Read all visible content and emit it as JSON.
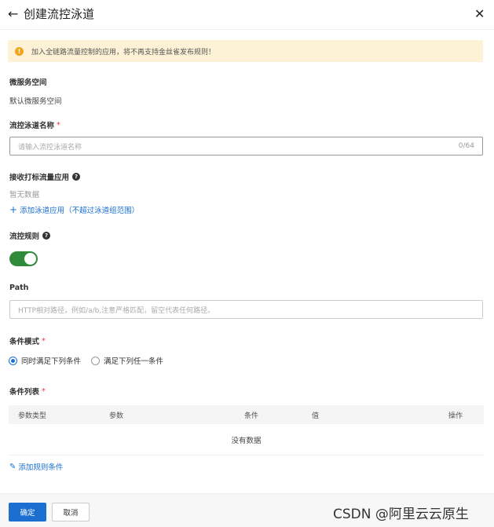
{
  "header": {
    "title": "创建流控泳道"
  },
  "alert": {
    "text": "加入全链路流量控制的应用，将不再支持金丝雀发布规则！"
  },
  "namespace": {
    "label": "微服务空间",
    "value": "默认微服务空间"
  },
  "lane_name": {
    "label": "流控泳道名称",
    "required_mark": "*",
    "placeholder": "请输入流控泳道名称",
    "counter": "0/64"
  },
  "receive_apps": {
    "label": "接收打标流量应用",
    "empty_text": "暂无数据",
    "add_link": "添加泳道应用（不超过泳道组范围）"
  },
  "rules": {
    "label": "流控规则",
    "enabled": true
  },
  "path": {
    "label": "Path",
    "placeholder": "HTTP相对路径，例如/a/b,注意严格匹配，留空代表任何路径。"
  },
  "condition_mode": {
    "label": "条件模式",
    "required_mark": "*",
    "options": [
      "同时满足下列条件",
      "满足下列任一条件"
    ],
    "selected": "同时满足下列条件"
  },
  "condition_list": {
    "label": "条件列表",
    "required_mark": "*",
    "columns": [
      "参数类型",
      "参数",
      "条件",
      "值",
      "操作"
    ],
    "empty_text": "没有数据",
    "add_link": "添加规则条件"
  },
  "footer": {
    "confirm": "确定",
    "cancel": "取消"
  },
  "watermark": "CSDN @阿里云云原生",
  "colors": {
    "primary": "#1a6fd1",
    "toggle_on": "#2f8a3a",
    "alert_bg": "#fdf2d6",
    "required": "#e5333a"
  }
}
